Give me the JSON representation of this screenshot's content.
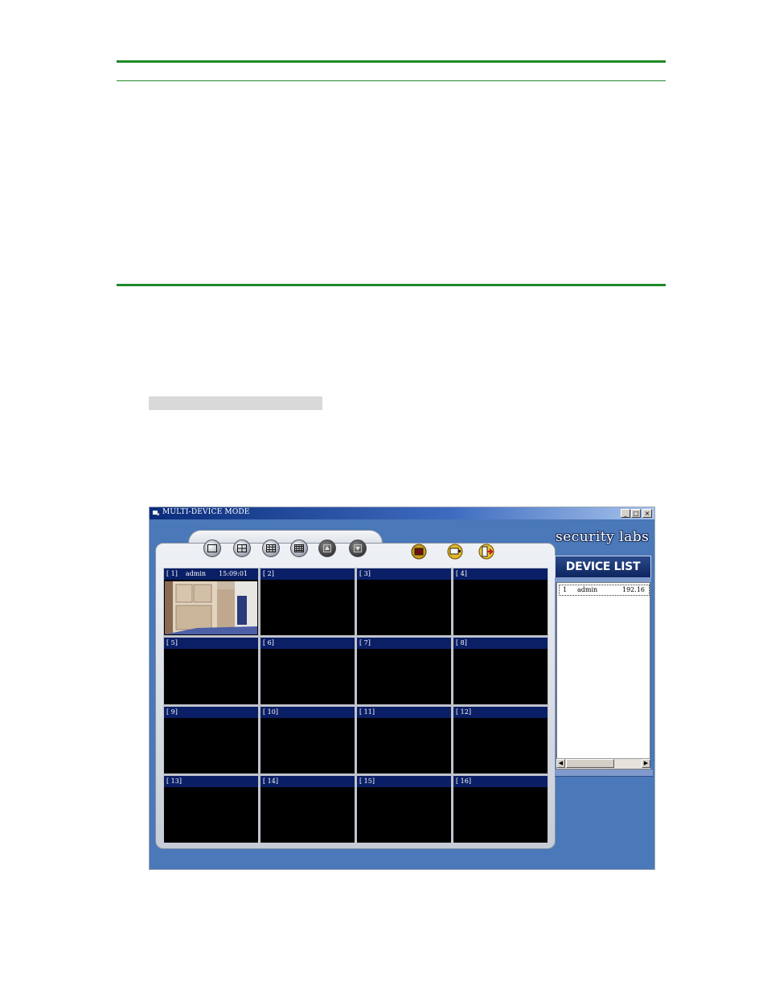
{
  "window": {
    "title": "MULTI-DEVICE MODE",
    "min_glyph": "_",
    "max_glyph": "□",
    "close_glyph": "×"
  },
  "brand": {
    "text": "security labs"
  },
  "device_list": {
    "header": "DEVICE LIST",
    "rows": [
      {
        "index": "1",
        "user": "admin",
        "ip": "192.16"
      }
    ]
  },
  "toolbar": {
    "layout_buttons": [
      "single-view-icon",
      "quad-view-icon",
      "nine-view-icon",
      "sixteen-view-icon"
    ],
    "nav_buttons": [
      "page-up-icon",
      "page-down-icon"
    ],
    "action_buttons": [
      "record-icon",
      "capture-icon",
      "exit-icon"
    ]
  },
  "channels": [
    {
      "label": "[ 1]",
      "user": "admin",
      "time": "15:09:01"
    },
    {
      "label": "[ 2]"
    },
    {
      "label": "[ 3]"
    },
    {
      "label": "[ 4]"
    },
    {
      "label": "[ 5]"
    },
    {
      "label": "[ 6]"
    },
    {
      "label": "[ 7]"
    },
    {
      "label": "[ 8]"
    },
    {
      "label": "[ 9]"
    },
    {
      "label": "[ 10]"
    },
    {
      "label": "[ 11]"
    },
    {
      "label": "[ 12]"
    },
    {
      "label": "[ 13]"
    },
    {
      "label": "[ 14]"
    },
    {
      "label": "[ 15]"
    },
    {
      "label": "[ 16]"
    }
  ],
  "colors": {
    "accent_rule": "#1f8a2a",
    "window_bg": "#4a78b8",
    "channel_header": "#0b1f66"
  }
}
